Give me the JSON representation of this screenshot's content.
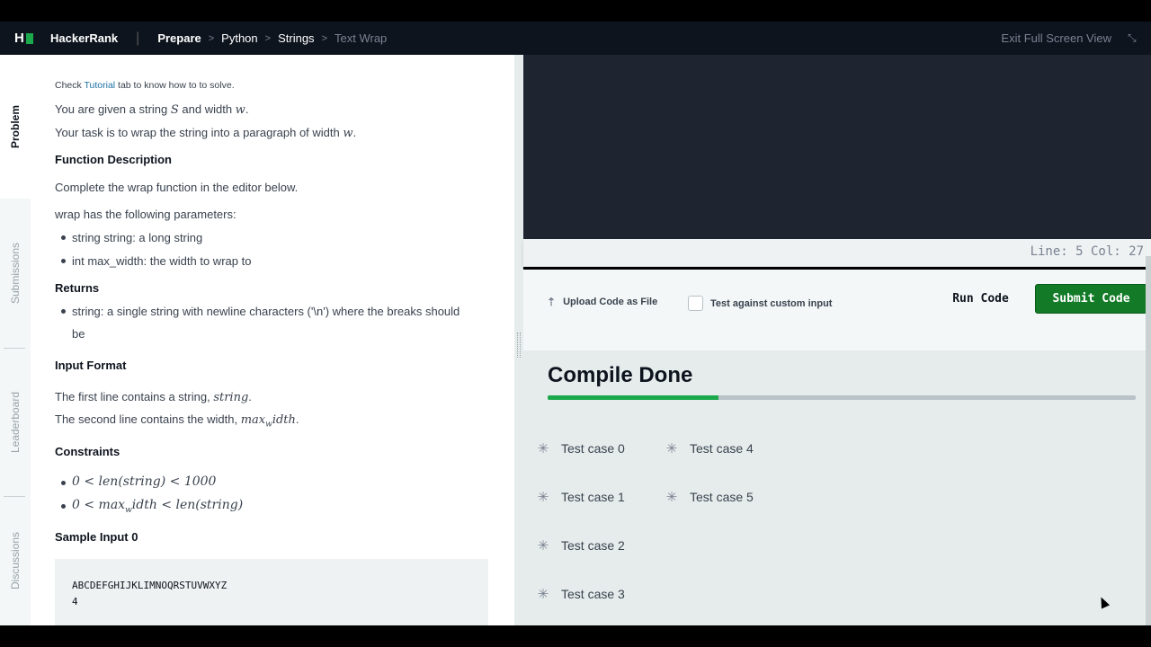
{
  "header": {
    "brand": "HackerRank",
    "breadcrumbs": [
      "Prepare",
      "Python",
      "Strings",
      "Text Wrap"
    ],
    "exit_fullscreen": "Exit Full Screen View"
  },
  "sidebar": {
    "tabs": [
      "Problem",
      "Submissions",
      "Leaderboard",
      "Discussions"
    ]
  },
  "problem": {
    "tutorial_prefix": "Check ",
    "tutorial_link": "Tutorial",
    "tutorial_suffix": " tab to know how to to solve.",
    "intro1_a": "You are given a string ",
    "intro1_s": "S",
    "intro1_b": " and width ",
    "intro1_w": "w",
    "intro1_end": ".",
    "intro2_a": "Your task is to wrap the string into a paragraph of width ",
    "intro2_w": "w",
    "intro2_end": ".",
    "func_desc_title": "Function Description",
    "func_desc": "Complete the wrap function in the editor below.",
    "params_intro": "wrap has the following parameters:",
    "params": [
      "string string: a long string",
      "int max_width: the width to wrap to"
    ],
    "returns_title": "Returns",
    "returns_line1": "string: a single string with newline characters ('\\n') where the breaks should",
    "returns_line2": "be",
    "input_format_title": "Input Format",
    "input1_a": "The first line contains a string, ",
    "input1_m": "string",
    "input1_end": ".",
    "input2_a": "The second line contains the width, ",
    "input2_m": "max",
    "input2_sub": "w",
    "input2_m2": "idth",
    "input2_end": ".",
    "constraints_title": "Constraints",
    "constraint1": "0 < len(string) < 1000",
    "constraint2_a": "0 < max",
    "constraint2_sub": "w",
    "constraint2_b": "idth < len(string)",
    "sample_title": "Sample Input 0",
    "sample_input": "ABCDEFGHIJKLIMNOQRSTUVWXYZ\n4"
  },
  "editor": {
    "status": "Line: 5 Col: 27"
  },
  "actions": {
    "upload": "Upload Code as File",
    "custom_input": "Test against custom input",
    "run": "Run Code",
    "submit": "Submit Code"
  },
  "results": {
    "title": "Compile Done",
    "progress": 0.29,
    "test_cases": [
      "Test case 0",
      "Test case 1",
      "Test case 2",
      "Test case 3",
      "Test case 4",
      "Test case 5"
    ]
  },
  "colors": {
    "accent": "#1ba94c",
    "submit": "#137b27",
    "header_bg": "#0e141e"
  }
}
